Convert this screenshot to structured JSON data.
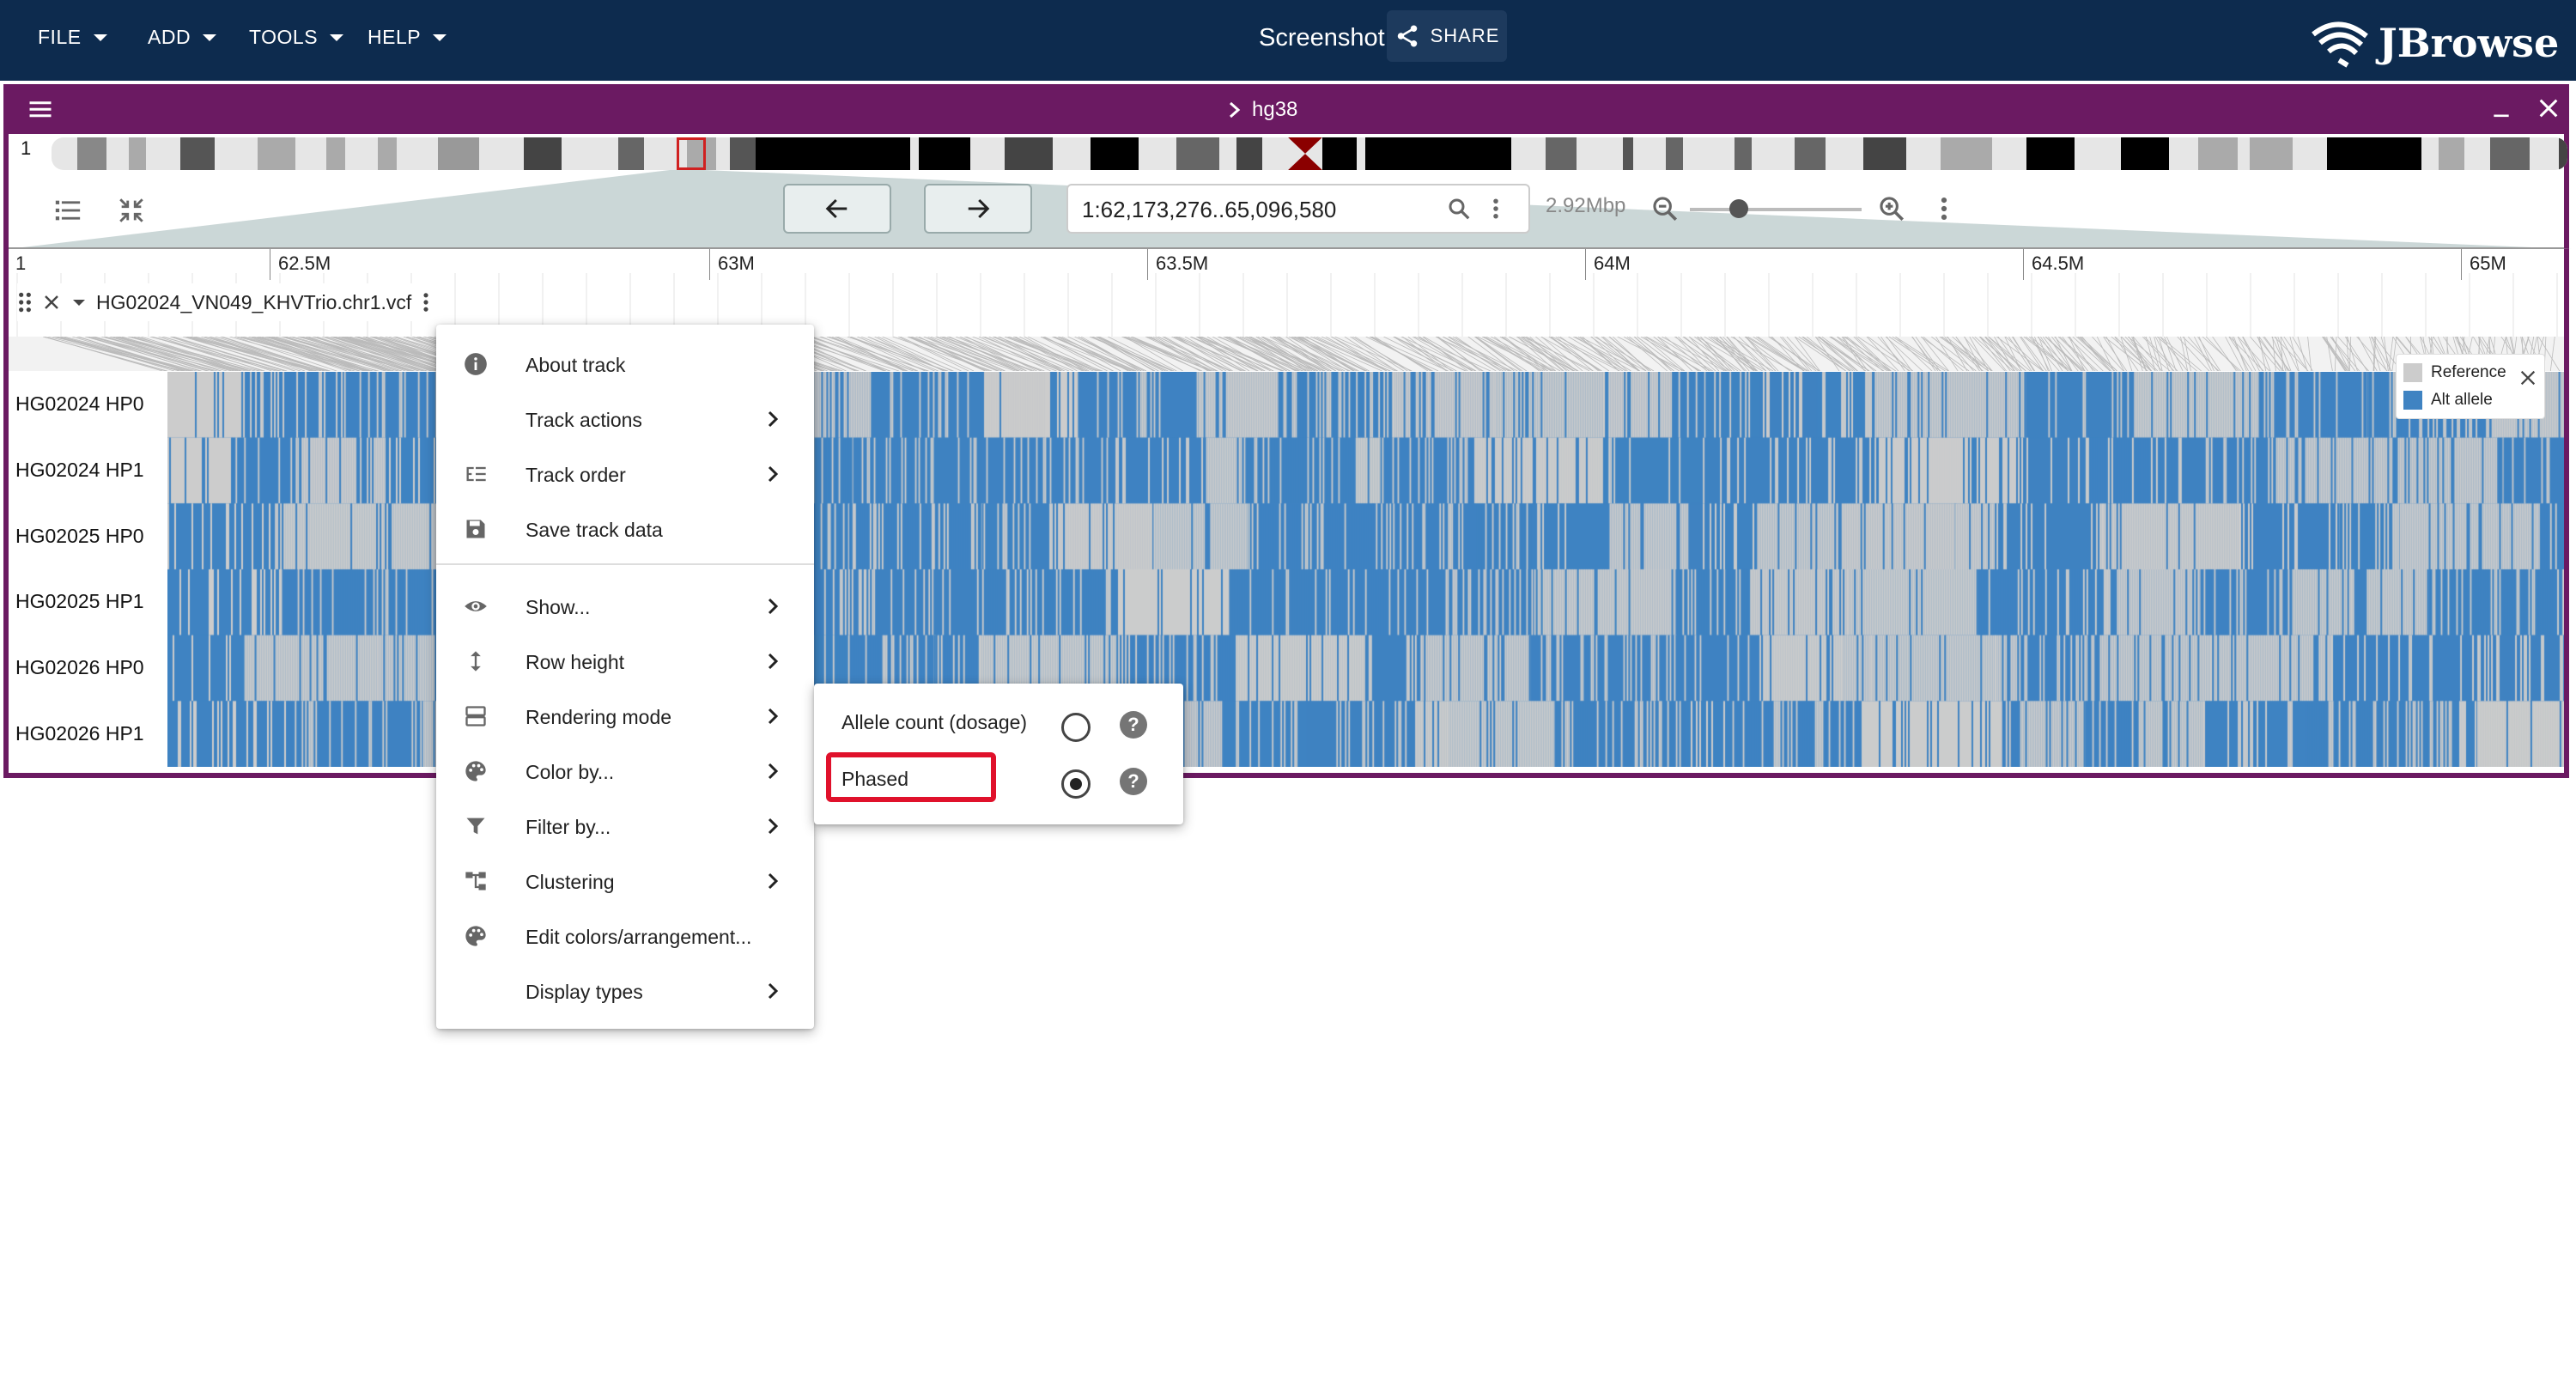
{
  "appbar": {
    "menus": [
      "FILE",
      "ADD",
      "TOOLS",
      "HELP"
    ],
    "title": "Screenshot",
    "share_label": "SHARE",
    "logo_text": "JBrowse",
    "bg_color": "#0d2b4e"
  },
  "view": {
    "assembly": "hg38",
    "header_color": "#6b1a62",
    "chromosome_label": "1",
    "location": "1:62,173,276..65,096,580",
    "span_label": "2.92Mbp",
    "ruler_start_label": "1",
    "ruler_ticks": [
      "62.5M",
      "63M",
      "63.5M",
      "64M",
      "64.5M",
      "65M"
    ]
  },
  "track": {
    "name": "HG02024_VN049_KHVTrio.chr1.vcf",
    "rows": [
      "HG02024 HP0",
      "HG02024 HP1",
      "HG02025 HP0",
      "HG02025 HP1",
      "HG02026 HP0",
      "HG02026 HP1"
    ],
    "legend": {
      "reference_label": "Reference",
      "alt_label": "Alt allele",
      "reference_color": "#cccccc",
      "alt_color": "#3f83c2"
    }
  },
  "menu": {
    "items": [
      {
        "label": "About track",
        "icon": "info-icon",
        "submenu": false
      },
      {
        "label": "Track actions",
        "icon": "",
        "submenu": true
      },
      {
        "label": "Track order",
        "icon": "sort-order-icon",
        "submenu": true
      },
      {
        "label": "Save track data",
        "icon": "save-icon",
        "submenu": false
      },
      {
        "label": "Show...",
        "icon": "eye-icon",
        "submenu": true
      },
      {
        "label": "Row height",
        "icon": "height-icon",
        "submenu": true
      },
      {
        "label": "Rendering mode",
        "icon": "rendering-mode-icon",
        "submenu": true
      },
      {
        "label": "Color by...",
        "icon": "palette-icon",
        "submenu": true
      },
      {
        "label": "Filter by...",
        "icon": "filter-icon",
        "submenu": true
      },
      {
        "label": "Clustering",
        "icon": "clustering-icon",
        "submenu": true
      },
      {
        "label": "Edit colors/arrangement...",
        "icon": "palette-icon",
        "submenu": false
      },
      {
        "label": "Display types",
        "icon": "",
        "submenu": true
      }
    ]
  },
  "rendering_submenu": {
    "options": [
      {
        "label": "Allele count (dosage)",
        "selected": false
      },
      {
        "label": "Phased",
        "selected": true
      }
    ],
    "highlight_color": "#e0112b"
  }
}
